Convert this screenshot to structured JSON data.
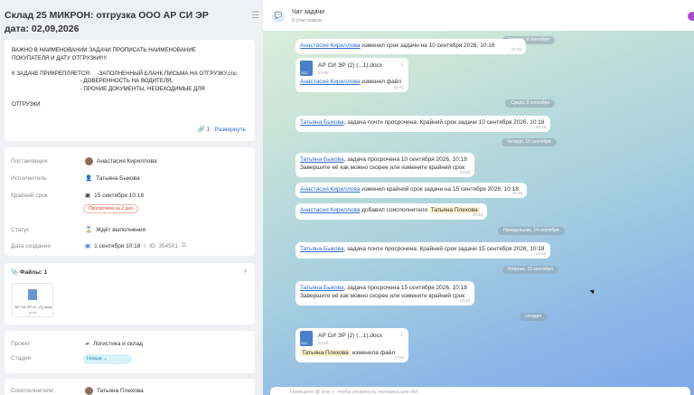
{
  "task": {
    "title": "Склад 25 МИКРОН:  отгрузка ООО АР СИ ЭР  дата: 02,09,2026",
    "description_lines": [
      "ВАЖНО В НАИМЕНОВАНИИ ЗАДАЧИ ПРОПИСАТЬ НАИМЕНОВАНИЕ",
      "ПОКУПАТЕЛЯ И ДАТУ ОТГРУЗКИ!!!!",
      "",
      "К ЗАДАЧЕ ПРИКРЕПЛЯЕТСЯ:    -ЗАПОЛНЕННЫЙ БЛАНК ПИСЬМА НА ОТГРУЗКУ,cnc",
      "                                            - ДОВЕРЕННОСТЬ НА ВОДИТЕЛЯ,",
      "                                            - ПРОЧИЕ ДОКУМЕНТЫ, НЕОБХОДИМЫЕ ДЛЯ",
      "",
      "ОТГРУЗКИ"
    ],
    "expand": {
      "count": "1",
      "label": "Развернуть"
    },
    "fields": {
      "creator_label": "Постановщик",
      "creator": "Анастасия Кириллова",
      "assignee_label": "Исполнитель",
      "assignee": "Татьяна Быкова",
      "deadline_label": "Крайний срок",
      "deadline": "15 сентября 10:18",
      "overdue": "Просрочена на 2 дня",
      "status_label": "Статус",
      "status": "Ждёт выполнения",
      "created_label": "Дата создания",
      "created": "1 сентября 10:18",
      "id": "ID: 354501"
    },
    "files": {
      "title": "Файлы: 1",
      "file_name": "АР СИ ЭР (2...(1).docx"
    },
    "project": {
      "label": "Проект",
      "value": "Логистика и склад",
      "stage_label": "Стадия",
      "stage": "Новые"
    },
    "co": {
      "label": "Соисполнители",
      "value": "Татьяна Плехова"
    }
  },
  "chat": {
    "title": "Чат задачи",
    "subtitle": "8 участников",
    "input_placeholder": "Напишите @ или +, чтобы упомянуть человека или ИИ",
    "dates": [
      "Четверг, 4 сентября",
      "Среда, 9 сентября",
      "Четверг, 10 сентября",
      "Понедельник, 14 сентября",
      "Вторник, 15 сентября",
      "сегодня"
    ],
    "m1": {
      "who": "Анастасия Кириллова",
      "text": "изменил срок задачи на 10 сентября 2026, 10:18"
    },
    "m2": {
      "file": "АР СИ ЭР (2) (...1).docx",
      "size": "23 Кб",
      "who": "Анастасия Кириллова",
      "text": "изменил файл",
      "time": "10:41"
    },
    "m3": {
      "who": "Татьяна Быкова",
      "text": ", задача почти просрочена. Крайний срок задачи 10 сентября 2026, 10:18",
      "time": "10:18"
    },
    "m4": {
      "who": "Татьяна Быкова",
      "text": ", задача просрочена 10 сентября 2026, 10:18",
      "text2": "Завершите её как можно скорее или измените крайний срок",
      "time": "10:18"
    },
    "m5": {
      "who": "Анастасия Кириллова",
      "text": "изменил крайний срок задачи на 15 сентября 2026, 10:18",
      "time": "10:18"
    },
    "m6": {
      "who": "Анастасия Кириллова",
      "text": "добавил соисполнителя",
      "tag": "Татьяна Плехова",
      "time": "10:42"
    },
    "m7": {
      "who": "Татьяна Быкова",
      "text": ", задача почти просрочена. Крайний срок задачи 15 сентября 2026, 10:18",
      "time": "10:18"
    },
    "m8": {
      "who": "Татьяна Быкова",
      "text": ", задача просрочена 15 сентября 2026, 10:18",
      "text2": "Завершите её как можно скорее или измените крайний срок",
      "time": "10:18"
    },
    "m9": {
      "file": "АР СИ ЭР (2) (...1).docx",
      "size": "23 Кб",
      "who": "Татьяна Плехова",
      "text": "изменила файл",
      "time": "17:04"
    }
  }
}
